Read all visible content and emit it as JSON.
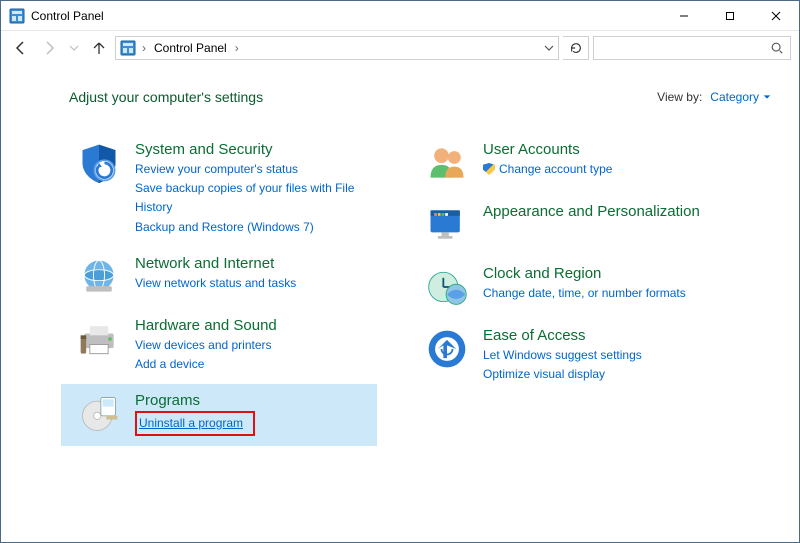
{
  "window": {
    "title": "Control Panel"
  },
  "breadcrumb": {
    "root": "Control Panel"
  },
  "search": {
    "placeholder": ""
  },
  "header": {
    "title": "Adjust your computer's settings",
    "viewby_label": "View by:",
    "viewby_value": "Category"
  },
  "cats": {
    "system": {
      "title": "System and Security",
      "link1": "Review your computer's status",
      "link2": "Save backup copies of your files with File History",
      "link3": "Backup and Restore (Windows 7)"
    },
    "network": {
      "title": "Network and Internet",
      "link1": "View network status and tasks"
    },
    "hardware": {
      "title": "Hardware and Sound",
      "link1": "View devices and printers",
      "link2": "Add a device"
    },
    "programs": {
      "title": "Programs",
      "link1": "Uninstall a program"
    },
    "users": {
      "title": "User Accounts",
      "link1": "Change account type"
    },
    "appearance": {
      "title": "Appearance and Personalization"
    },
    "clock": {
      "title": "Clock and Region",
      "link1": "Change date, time, or number formats"
    },
    "ease": {
      "title": "Ease of Access",
      "link1": "Let Windows suggest settings",
      "link2": "Optimize visual display"
    }
  }
}
